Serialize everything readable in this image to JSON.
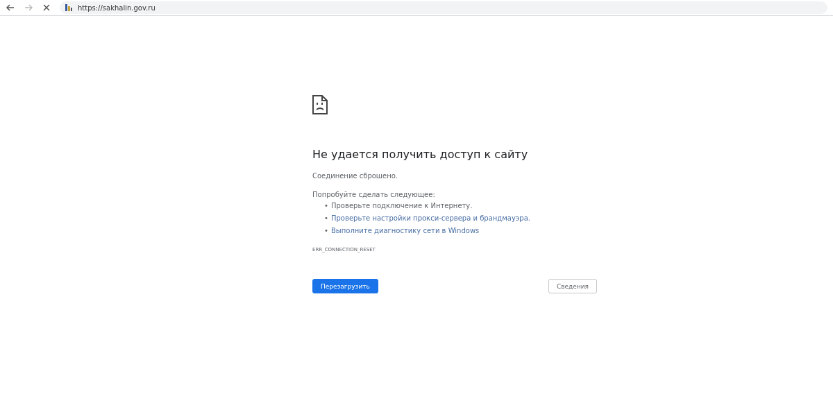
{
  "address_bar": {
    "url": "https://sakhalin.gov.ru"
  },
  "error": {
    "title": "Не удается получить доступ к сайту",
    "message": "Соединение сброшено.",
    "suggestions_heading": "Попробуйте сделать следующее:",
    "suggestions": [
      {
        "kind": "text",
        "bullet": "•",
        "text": "Проверьте подключение к Интернету."
      },
      {
        "kind": "link",
        "bullet": "•",
        "text": "Проверьте настройки прокси-сервера и брандмауэра."
      },
      {
        "kind": "link",
        "bullet": "•",
        "text": "Выполните диагностику сети в Windows"
      }
    ],
    "code": "ERR_CONNECTION_RESET"
  },
  "buttons": [
    {
      "kind": "primary",
      "label": "Перезагрузить"
    },
    {
      "kind": "secondary",
      "label": "Сведения"
    }
  ]
}
